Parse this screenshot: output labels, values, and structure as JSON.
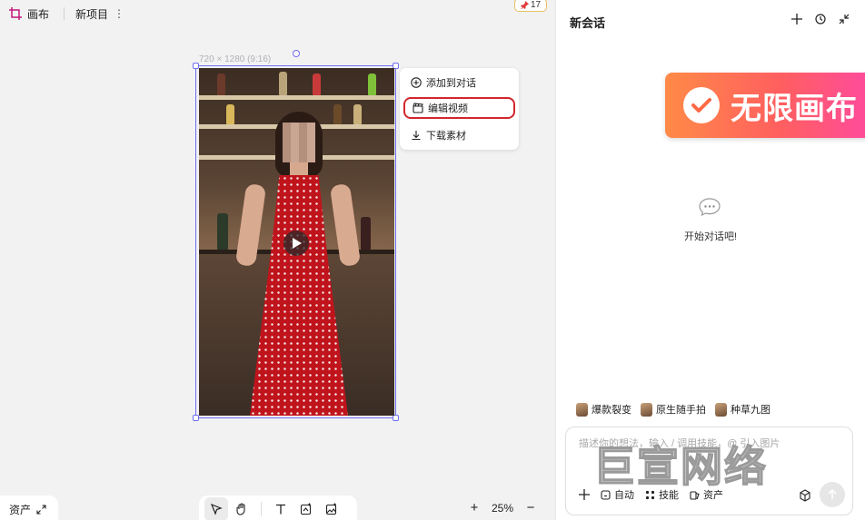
{
  "topbar": {
    "canvas_label": "画布",
    "project_name": "新项目",
    "more_glyph": "⋮"
  },
  "pin_badge": {
    "icon": "pin-icon",
    "count": "17"
  },
  "canvas": {
    "frame_size_label": "720 × 1280 (9:16)",
    "video": {
      "kind": "video-thumbnail"
    }
  },
  "context_menu": {
    "items": [
      {
        "label": "添加到对话",
        "icon": "plus-circle-icon"
      },
      {
        "label": "编辑视频",
        "icon": "clapperboard-icon",
        "highlighted": true
      },
      {
        "label": "下载素材",
        "icon": "download-icon"
      }
    ]
  },
  "bottom": {
    "assets_label": "资产",
    "zoom_level": "25%",
    "zoom_in": "+",
    "zoom_out": "−",
    "tools": [
      "select-tool",
      "hand-tool",
      "text-tool",
      "ai-edit-tool",
      "image-tool"
    ]
  },
  "panel": {
    "title": "新会话",
    "promo_text": "无限画布",
    "empty_text": "开始对话吧!",
    "chips": [
      {
        "label": "爆款裂变"
      },
      {
        "label": "原生随手拍"
      },
      {
        "label": "种草九图"
      }
    ],
    "composer": {
      "placeholder": "描述你的想法，输入 / 调用技能，@ 引入图片",
      "auto_label": "自动",
      "skills_label": "技能",
      "assets_label": "资产"
    }
  },
  "watermark": "巨宣网络",
  "colors": {
    "accent": "#6e6ef0",
    "highlight": "#d3262c",
    "dress": "#c0141c"
  }
}
